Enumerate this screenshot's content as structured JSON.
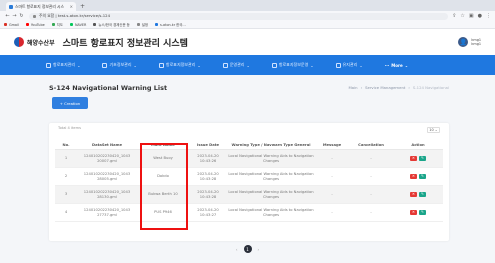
{
  "browser": {
    "tab_title": "스마트 항로표지 정보관리 시스",
    "url": "주의 요함 | test.s-aton.kr/service/s-124",
    "bookmarks": [
      "Gmail",
      "YouTube",
      "지도",
      "NAVER",
      "뉴스/한국 경제신문 등",
      "설정",
      "s-aton.kr 한국..."
    ]
  },
  "header": {
    "org_name": "해양수산부",
    "site_title": "스마트 항로표지 정보관리 시스템",
    "user_name": "kmg1",
    "user_sub": "kmg1"
  },
  "nav": {
    "items": [
      "항로표지관리",
      "기초정보관리",
      "항로표지정보관리",
      "운영관리",
      "항로표지정보운영",
      "유지관리"
    ],
    "more": "More"
  },
  "page": {
    "title": "S-124 Navigational Warning List",
    "breadcrumb": [
      "Main",
      "Service Management",
      "S-124 Navigational"
    ],
    "create_label": "+ Creation"
  },
  "table": {
    "total_text": "Total 4 items",
    "per_page": "10",
    "columns": [
      "No.",
      "DataSet Name",
      "Mark Name",
      "Issue Date",
      "Warning Type / Navwarn Type General",
      "Message",
      "Cancellation",
      "Action"
    ],
    "rows": [
      {
        "no": "1",
        "dataset": "124010202230420_1043 20007.gml",
        "mark": "West Buoy",
        "date": "2023-04-20 10:43:26",
        "type": "Local Navigational Warning Aids to Navigation Changes",
        "message": "-",
        "cancel": "-"
      },
      {
        "no": "2",
        "dataset": "124010202230420_1043 28005.gml",
        "mark": "Dokdo",
        "date": "2023-04-20 10:43:28",
        "type": "Local Navigational Warning Aids to Navigation Changes",
        "message": "-",
        "cancel": "-"
      },
      {
        "no": "3",
        "dataset": "124010202230420_1043 28130.gml",
        "mark": "Bukwa Berth 10",
        "date": "2023-04-20 10:43:28",
        "type": "Local Navigational Warning Aids to Navigation Changes",
        "message": "-",
        "cancel": "-"
      },
      {
        "no": "4",
        "dataset": "124010202230420_1043 27737.gml",
        "mark": "PUS P946",
        "date": "2023-04-20 10:43:27",
        "type": "Local Navigational Warning Aids to Navigation Changes",
        "message": "-",
        "cancel": "-"
      }
    ]
  },
  "pagination": {
    "prev": "‹",
    "current": "1",
    "next": "›"
  },
  "colors": {
    "nav_blue": "#1f78e0",
    "delete_red": "#e53935",
    "edit_green": "#1aa58a",
    "highlight": "#ee1111"
  }
}
